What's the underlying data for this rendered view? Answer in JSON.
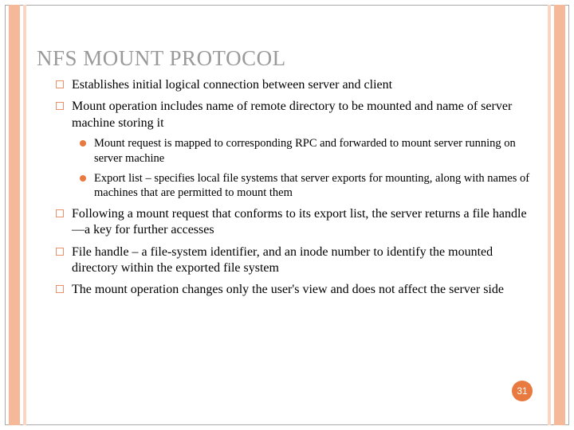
{
  "title": "NFS MOUNT PROTOCOL",
  "bullets": {
    "b1": "Establishes initial logical connection between server and client",
    "b2": "Mount operation includes name of remote directory to be mounted and name of server machine storing it",
    "b2a": "Mount request is mapped to corresponding RPC and forwarded to mount server running on server machine",
    "b2b": "Export list – specifies local file systems that server exports for mounting, along with names of machines that are permitted to mount them",
    "b3": "Following a mount request that conforms to its export list, the server returns a file handle—a key for further accesses",
    "b4": "File handle – a file-system identifier, and an inode number to identify the mounted directory within the exported file system",
    "b5": "The mount operation changes only the user's view and does not affect the server side"
  },
  "page_number": "31"
}
